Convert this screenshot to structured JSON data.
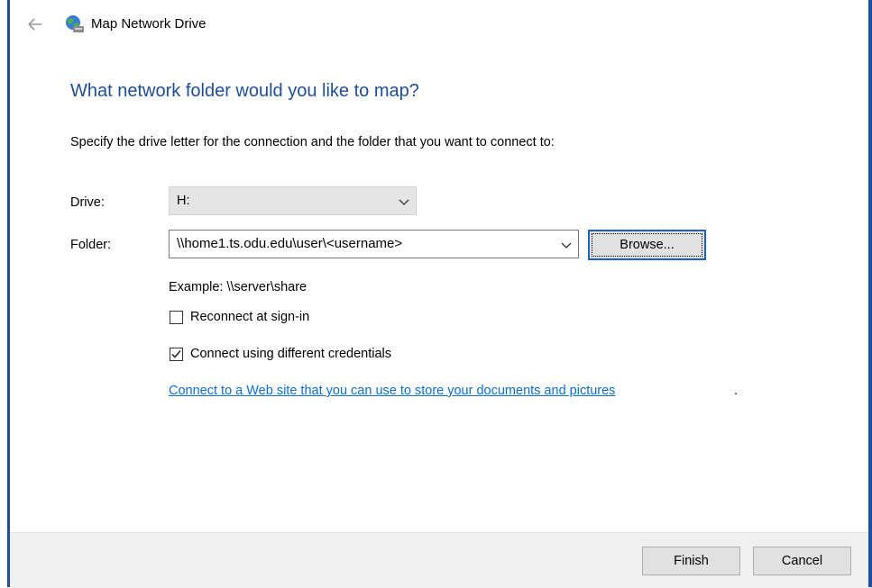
{
  "window": {
    "title": "Map Network Drive",
    "accent_color": "#1e4f9b"
  },
  "icons": {
    "back": "back-arrow-icon",
    "app": "network-drive-icon",
    "dropdown": "chevron-down-icon"
  },
  "header": {
    "heading": "What network folder would you like to map?"
  },
  "instruction": "Specify the drive letter for the connection and the folder that you want to connect to:",
  "drive": {
    "label": "Drive:",
    "value": "H:"
  },
  "folder": {
    "label": "Folder:",
    "value": "\\\\home1.ts.odu.edu\\user\\<username>",
    "browse_label": "Browse..."
  },
  "example": "Example: \\\\server\\share",
  "options": [
    {
      "label": "Reconnect at sign-in",
      "checked": false
    },
    {
      "label": "Connect using different credentials",
      "checked": true
    }
  ],
  "link": {
    "text": "Connect to a Web site that you can use to store your documents and pictures",
    "suffix": "."
  },
  "footer": {
    "finish_label": "Finish",
    "cancel_label": "Cancel"
  }
}
